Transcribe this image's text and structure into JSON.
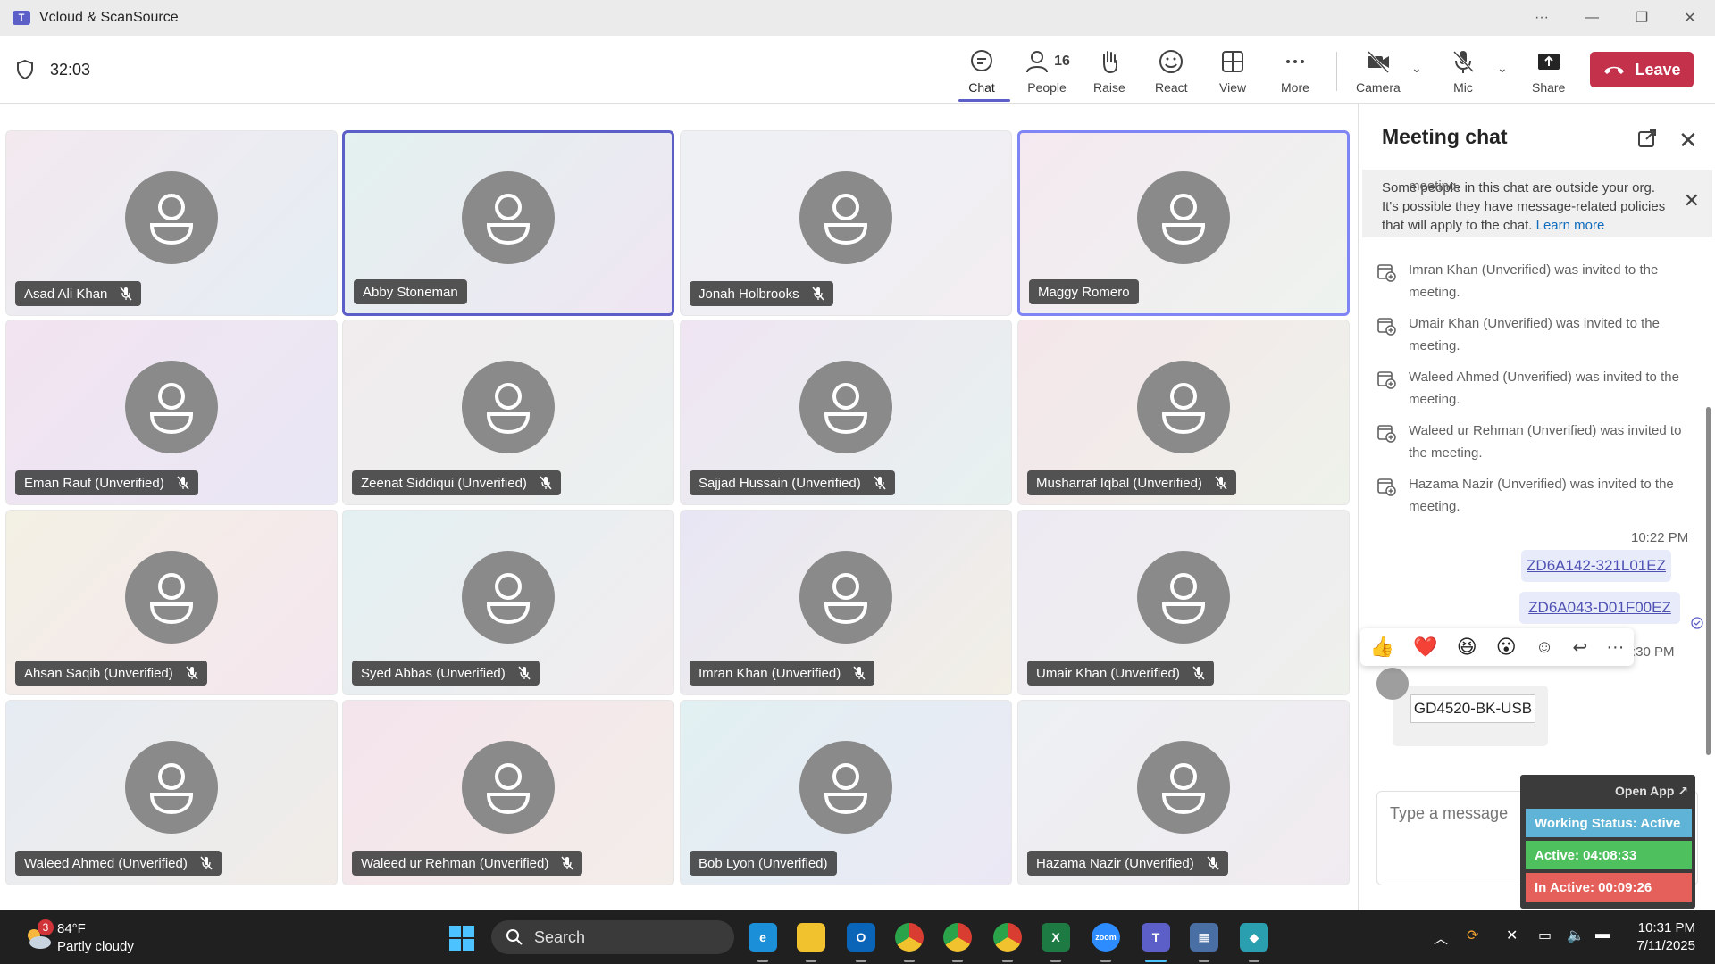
{
  "window": {
    "title": "Vcloud & ScanSource",
    "app_icon": "teams-icon"
  },
  "toolbar": {
    "timer": "32:03",
    "people_count": "16",
    "buttons": {
      "chat": "Chat",
      "people": "People",
      "raise": "Raise",
      "react": "React",
      "view": "View",
      "more": "More",
      "camera": "Camera",
      "mic": "Mic",
      "share": "Share"
    },
    "leave": "Leave"
  },
  "participants": [
    {
      "name": "Asad Ali Khan",
      "muted": true
    },
    {
      "name": "Abby Stoneman",
      "muted": false,
      "speaking": true
    },
    {
      "name": "Jonah Holbrooks",
      "muted": true
    },
    {
      "name": "Maggy Romero",
      "muted": false,
      "speaking": true
    },
    {
      "name": "Eman Rauf (Unverified)",
      "muted": true
    },
    {
      "name": "Zeenat Siddiqui (Unverified)",
      "muted": true
    },
    {
      "name": "Sajjad Hussain (Unverified)",
      "muted": true
    },
    {
      "name": "Musharraf Iqbal (Unverified)",
      "muted": true
    },
    {
      "name": "Ahsan Saqib (Unverified)",
      "muted": true
    },
    {
      "name": "Syed Abbas (Unverified)",
      "muted": true
    },
    {
      "name": "Imran Khan (Unverified)",
      "muted": true
    },
    {
      "name": "Umair Khan (Unverified)",
      "muted": true
    },
    {
      "name": "Waleed Ahmed (Unverified)",
      "muted": true
    },
    {
      "name": "Waleed ur Rehman (Unverified)",
      "muted": true
    },
    {
      "name": "Bob Lyon (Unverified)",
      "muted": false
    },
    {
      "name": "Hazama Nazir (Unverified)",
      "muted": true
    }
  ],
  "chat": {
    "title": "Meeting chat",
    "banner": {
      "text": "Some people in this chat are outside your org. It's possible they have message-related policies that will apply to the chat.",
      "link": "Learn more"
    },
    "partial_top": "meeting.",
    "system_messages": [
      {
        "line1": "Imran Khan (Unverified) was invited to the",
        "line2": "meeting."
      },
      {
        "line1": "Umair Khan (Unverified) was invited to the",
        "line2": "meeting."
      },
      {
        "line1": "Waleed Ahmed (Unverified) was invited to the",
        "line2": "meeting."
      },
      {
        "line1": "Waleed ur Rehman (Unverified) was invited to",
        "line2": "the meeting."
      },
      {
        "line1": "Hazama Nazir (Unverified) was invited to the",
        "line2": "meeting."
      }
    ],
    "time1": "10:22 PM",
    "my_messages": [
      "ZD6A142-321L01EZ",
      "ZD6A043-D01F00EZ"
    ],
    "reactions": [
      "👍",
      "❤️",
      "😆",
      "😮"
    ],
    "time2": ":30 PM",
    "their_message": "GD4520-BK-USB",
    "compose_placeholder": "Type a message"
  },
  "tracker": {
    "open_app": "Open App ↗",
    "status": "Working Status: Active",
    "active": "Active: 04:08:33",
    "inactive": "In Active: 00:09:26",
    "colors": {
      "status": "#5fb3d6",
      "active": "#4fc05e",
      "inactive": "#e5605a"
    }
  },
  "taskbar": {
    "weather": {
      "badge": "3",
      "temp": "84°F",
      "condition": "Partly cloudy"
    },
    "search": "Search",
    "apps": [
      "edge-icon",
      "file-explorer-icon",
      "outlook-icon",
      "chrome-icon",
      "chrome-icon",
      "chrome-icon",
      "excel-icon",
      "zoom-icon",
      "teams-icon",
      "calculator-icon",
      "app-icon"
    ],
    "time": "10:31 PM",
    "date": "7/11/2025"
  },
  "colors": {
    "accent": "#5b5fc7",
    "leave": "#c4314b"
  }
}
